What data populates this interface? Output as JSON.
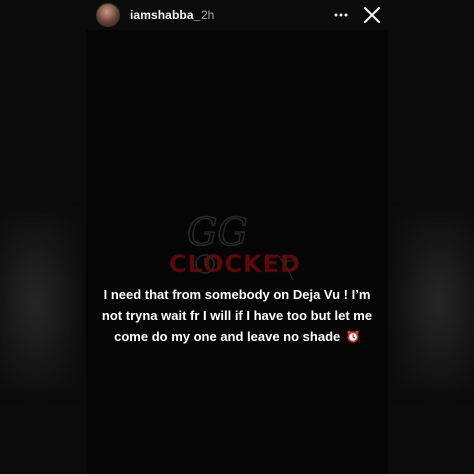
{
  "header": {
    "username": "iamshabba_",
    "time": "2h",
    "more_icon": "more-horizontal-icon",
    "close_icon": "close-icon"
  },
  "story": {
    "text": "I need that from somebody on Deja Vu ! I’m not tryna wait fr I will if I have too but let me come do my one and leave no shade",
    "emoji": "alarm-clock-icon"
  },
  "watermark": {
    "line1": "GG",
    "line2": "CLOCKED"
  },
  "colors": {
    "background": "#0b0b0b",
    "text": "#ffffff",
    "muted": "#a8a8a8",
    "watermark_red": "#6d0a0a"
  }
}
